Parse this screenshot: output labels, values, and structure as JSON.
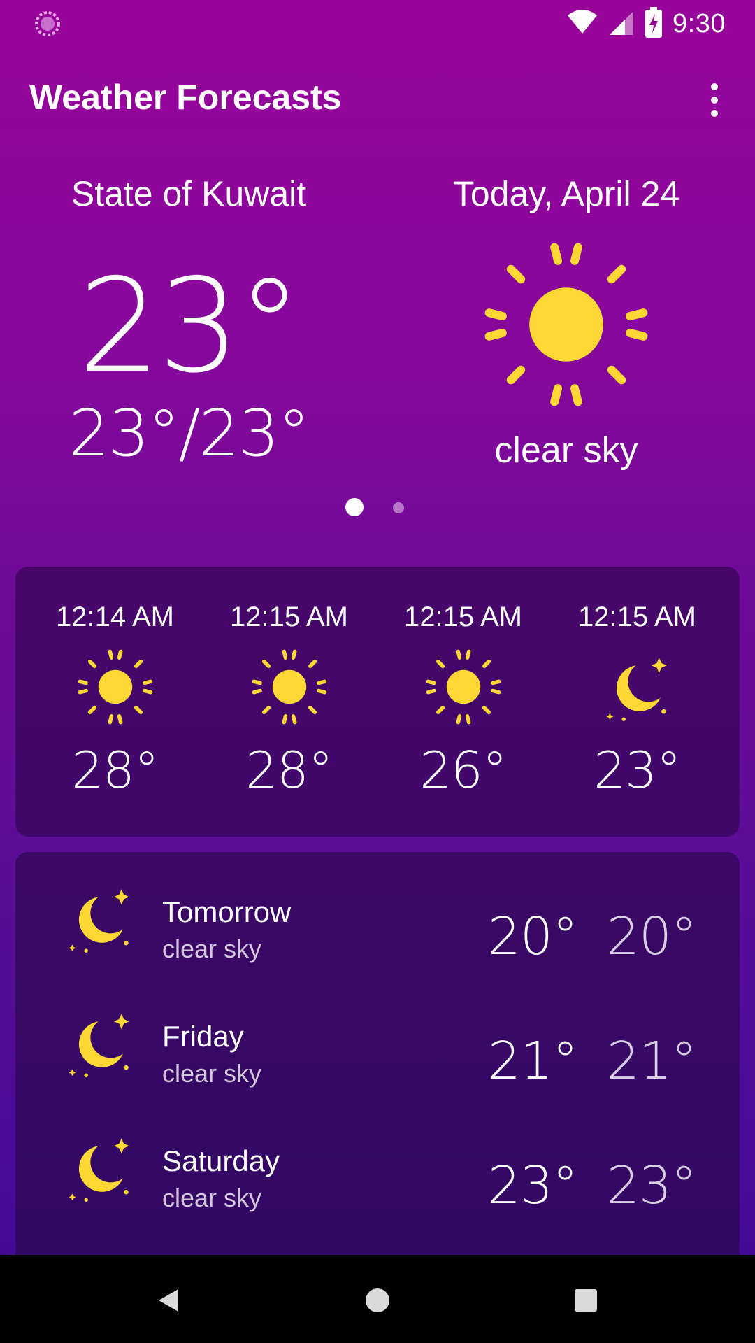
{
  "status_bar": {
    "time": "9:30",
    "icons": [
      "loading-icon",
      "wifi-icon",
      "signal-icon",
      "battery-charging-icon"
    ]
  },
  "app_bar": {
    "title": "Weather Forecasts",
    "menu_icon": "overflow-menu-icon"
  },
  "current": {
    "location": "State of Kuwait",
    "date": "Today, April 24",
    "temperature": "23°",
    "range": "23°/23°",
    "condition": "clear sky",
    "icon": "sun-icon"
  },
  "pager": {
    "pages": 2,
    "active": 1
  },
  "hourly": [
    {
      "time": "12:14 AM",
      "icon": "sun-icon",
      "temp": "28°"
    },
    {
      "time": "12:15 AM",
      "icon": "sun-icon",
      "temp": "28°"
    },
    {
      "time": "12:15 AM",
      "icon": "sun-icon",
      "temp": "26°"
    },
    {
      "time": "12:15 AM",
      "icon": "moon-stars-icon",
      "temp": "23°"
    }
  ],
  "daily": [
    {
      "day": "Tomorrow",
      "condition": "clear sky",
      "high": "20°",
      "low": "20°",
      "icon": "moon-stars-icon"
    },
    {
      "day": "Friday",
      "condition": "clear sky",
      "high": "21°",
      "low": "21°",
      "icon": "moon-stars-icon"
    },
    {
      "day": "Saturday",
      "condition": "clear sky",
      "high": "23°",
      "low": "23°",
      "icon": "moon-stars-icon"
    }
  ],
  "nav_bar": {
    "buttons": [
      "back-icon",
      "home-icon",
      "recents-icon"
    ]
  },
  "colors": {
    "background_top": "#98049a",
    "background_bottom": "#3f0a95",
    "icon_yellow": "#fdd835",
    "card_background": "#2a0646"
  }
}
